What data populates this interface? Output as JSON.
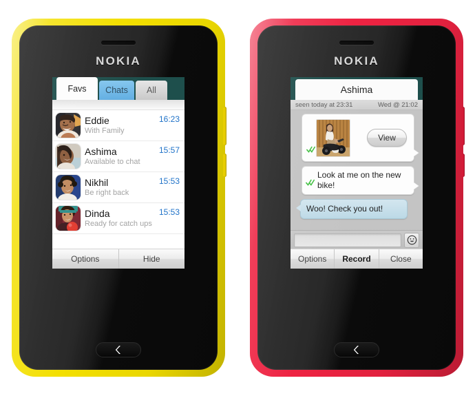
{
  "theme": {
    "teal": "#1E4F4C",
    "accent_blue": "#1f72c8",
    "tab_chats_blue": "#6DB9E8",
    "bubble_in": "#C9DEE8",
    "tick_green": "#3FBF3F"
  },
  "phones": [
    {
      "id": "phone-left",
      "shell_color": "#F3DF00",
      "shell_name": "yellow",
      "brand": "NOKIA"
    },
    {
      "id": "phone-right",
      "shell_color": "#EE2342",
      "shell_name": "red",
      "brand": "NOKIA"
    }
  ],
  "contacts_screen": {
    "tabs": [
      {
        "label": "Favs",
        "state": "active"
      },
      {
        "label": "Chats",
        "state": "highlighted"
      },
      {
        "label": "All",
        "state": "inactive"
      }
    ],
    "contacts": [
      {
        "name": "Eddie",
        "status": "With Family",
        "time": "16:23",
        "avatar": "avatar-eddie"
      },
      {
        "name": "Ashima",
        "status": "Available to chat",
        "time": "15:57",
        "avatar": "avatar-ashima"
      },
      {
        "name": "Nikhil",
        "status": "Be right back",
        "time": "15:53",
        "avatar": "avatar-nikhil"
      },
      {
        "name": "Dinda",
        "status": "Ready for catch ups",
        "time": "15:53",
        "avatar": "avatar-dinda"
      }
    ],
    "softkeys": [
      {
        "label": "Options",
        "emphasis": "normal"
      },
      {
        "label": "Hide",
        "emphasis": "normal"
      }
    ]
  },
  "chat_screen": {
    "title": "Ashima",
    "seen_status": "seen today at 23:31",
    "timestamp": "Wed @ 21:02",
    "messages": [
      {
        "kind": "media",
        "direction": "outgoing",
        "delivery": "read",
        "attachment": "photo-woman-on-motorbike",
        "action_label": "View"
      },
      {
        "kind": "text",
        "direction": "outgoing",
        "delivery": "read",
        "text": "Look at me on the new bike!"
      },
      {
        "kind": "text",
        "direction": "incoming",
        "delivery": "none",
        "text": "Woo! Check you out!"
      }
    ],
    "composer": {
      "value": "",
      "placeholder": "",
      "emoji_icon": "smiley-icon"
    },
    "softkeys": [
      {
        "label": "Options",
        "emphasis": "normal"
      },
      {
        "label": "Record",
        "emphasis": "bold"
      },
      {
        "label": "Close",
        "emphasis": "normal"
      }
    ]
  },
  "hardware": {
    "back_key_icon": "chevron-left-icon",
    "earpiece": "earpiece-slot",
    "volume_key": "volume-rocker",
    "power_key": "power-key"
  }
}
